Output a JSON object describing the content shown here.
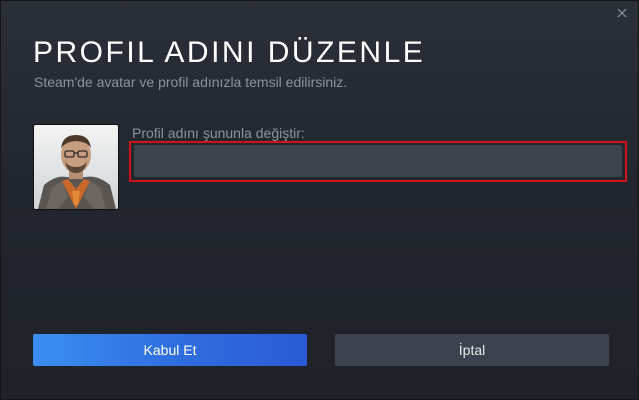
{
  "dialog": {
    "title": "PROFIL ADINI DÜZENLE",
    "subtitle": "Steam'de avatar ve profil adınızla temsil edilirsiniz.",
    "close_icon": "close-icon"
  },
  "profile": {
    "field_label": "Profil adını şununla değiştir:",
    "name_value": "",
    "avatar_icon": "avatar-portrait"
  },
  "buttons": {
    "accept_label": "Kabul Et",
    "cancel_label": "İptal"
  },
  "colors": {
    "accent": "#3b8ef0",
    "highlight_border": "#d0121a",
    "background": "#22262e"
  }
}
